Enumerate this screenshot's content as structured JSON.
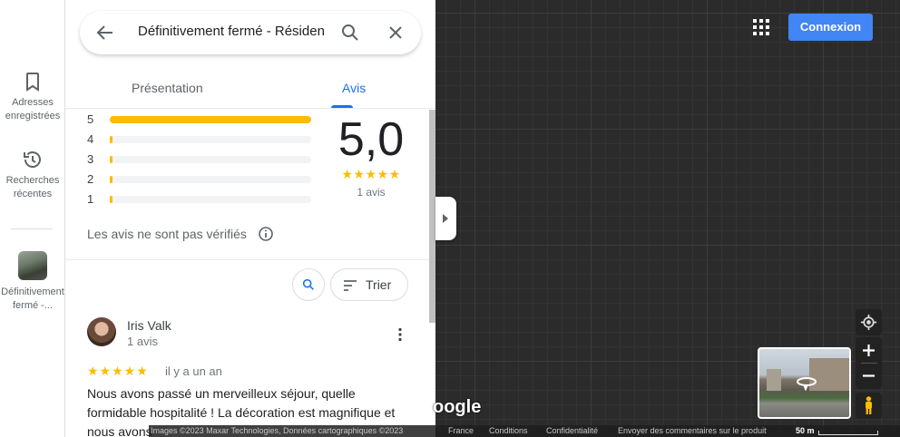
{
  "rail": {
    "saved_label": "Adresses enregistrées",
    "saved_line1": "Adresses",
    "saved_line2": "enregistrées",
    "recent_line1": "Recherches",
    "recent_line2": "récentes",
    "place_line1": "Définitivement",
    "place_line2": "fermé -..."
  },
  "search": {
    "query": "Définitivement fermé - Résiden"
  },
  "tabs": [
    {
      "label": "Présentation",
      "active": false
    },
    {
      "label": "Avis",
      "active": true
    }
  ],
  "rating": {
    "score": "5,0",
    "stars": "★★★★★",
    "count_text": "1 avis",
    "distribution": [
      {
        "stars": "5",
        "fraction": 1.0
      },
      {
        "stars": "4",
        "fraction": 0.0
      },
      {
        "stars": "3",
        "fraction": 0.0
      },
      {
        "stars": "2",
        "fraction": 0.0
      },
      {
        "stars": "1",
        "fraction": 0.0
      }
    ],
    "star_color": "#fbbc04"
  },
  "notice": "Les avis ne sont pas vérifiés",
  "sort_label": "Trier",
  "review": {
    "author": "Iris Valk",
    "author_reviews": "1 avis",
    "stars": "★★★★★",
    "time": "il y a un an",
    "text": "Nous avons passé un merveilleux séjour, quelle formidable hospitalité ! La décoration est magnifique et nous avons"
  },
  "map": {
    "login_label": "Connexion",
    "logo_text": "oogle",
    "accent": "#4285f4"
  },
  "footer": {
    "attribution": "Images ©2023 Maxar Technologies, Données cartographiques ©2023",
    "country": "France",
    "terms": "Conditions",
    "privacy": "Confidentialité",
    "feedback": "Envoyer des commentaires sur le produit",
    "scale": "50 m"
  }
}
